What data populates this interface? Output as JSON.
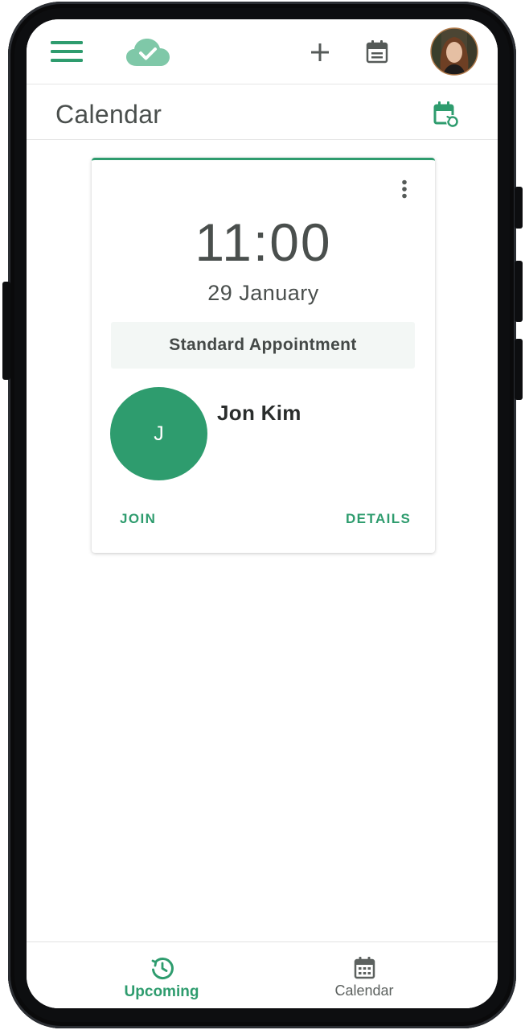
{
  "colors": {
    "accent": "#2e9c6e",
    "text_dark": "#4a4f4d",
    "icon_gray": "#555a58",
    "bezel": "#0d0e10"
  },
  "topbar": {
    "icons": [
      "menu-icon",
      "cloud-check-icon",
      "plus-icon",
      "calendar-icon",
      "profile-avatar"
    ]
  },
  "header": {
    "title": "Calendar",
    "action_icon": "calendar-sync-icon"
  },
  "appointment": {
    "time": "11:00",
    "date": "29 January",
    "type": "Standard Appointment",
    "initial": "J",
    "name": "Jon Kim",
    "join_label": "JOIN",
    "details_label": "DETAILS",
    "menu_icon": "more-vertical-icon"
  },
  "bottom_nav": {
    "items": [
      {
        "label": "Upcoming",
        "icon": "clock-history-icon",
        "active": true
      },
      {
        "label": "Calendar",
        "icon": "calendar-grid-icon",
        "active": false
      }
    ]
  }
}
